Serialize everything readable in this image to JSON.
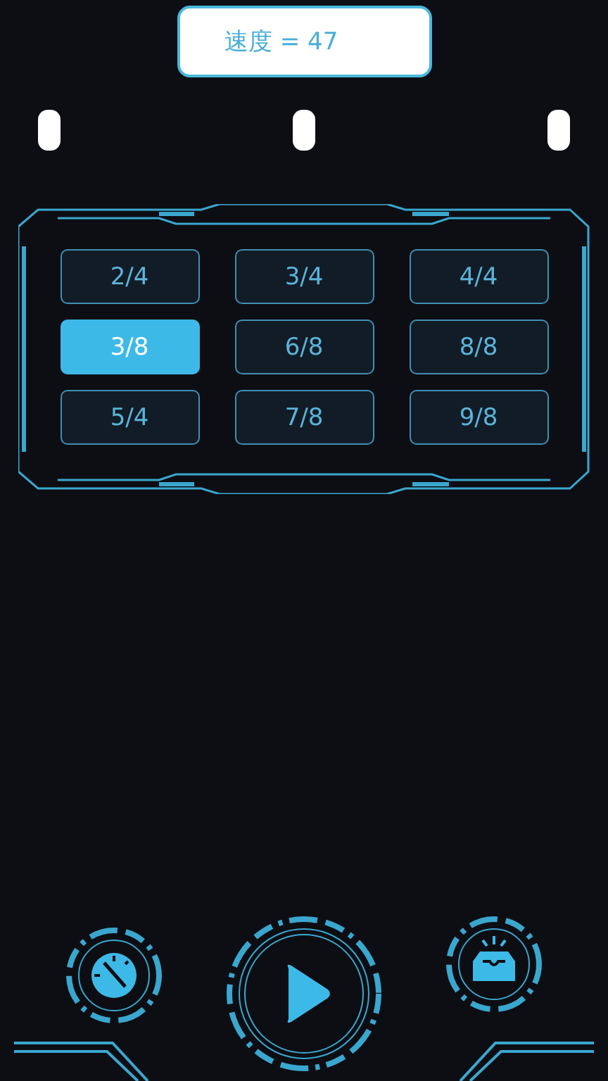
{
  "speed": {
    "label": "速度 = 47"
  },
  "time_signatures": [
    {
      "label": "2/4",
      "selected": false
    },
    {
      "label": "3/4",
      "selected": false
    },
    {
      "label": "4/4",
      "selected": false
    },
    {
      "label": "3/8",
      "selected": true
    },
    {
      "label": "6/8",
      "selected": false
    },
    {
      "label": "8/8",
      "selected": false
    },
    {
      "label": "5/4",
      "selected": false
    },
    {
      "label": "7/8",
      "selected": false
    },
    {
      "label": "9/8",
      "selected": false
    }
  ],
  "controls": [
    {
      "kind": "gauge"
    },
    {
      "kind": "play"
    },
    {
      "kind": "tray"
    }
  ]
}
